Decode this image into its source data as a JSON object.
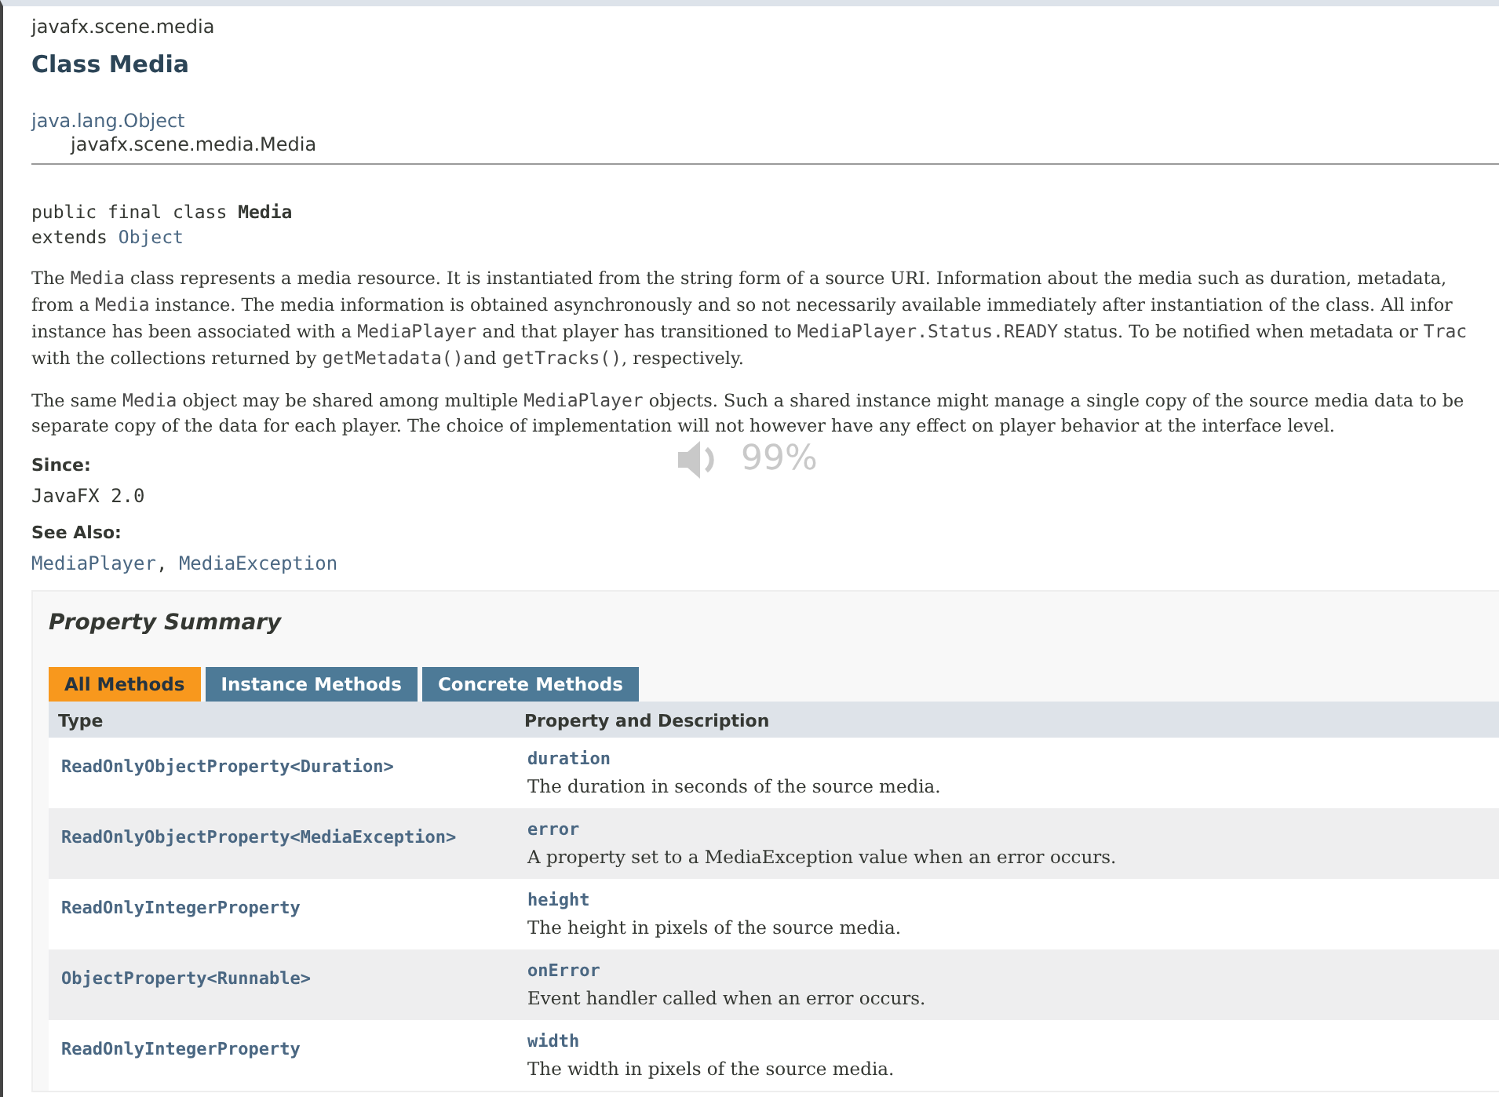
{
  "package": "javafx.scene.media",
  "title": "Class Media",
  "inheritance": [
    "java.lang.Object",
    "javafx.scene.media.Media"
  ],
  "signature": {
    "prefix": "public final class ",
    "name": "Media",
    "extends_keyword": "extends ",
    "extends_type": "Object"
  },
  "description": [
    [
      [
        {
          "text": "The ",
          "kind": "text"
        },
        {
          "text": "Media",
          "kind": "code"
        },
        {
          "text": " class represents a media resource. It is instantiated from the string form of a source URI. Information about the media such as duration, metadata,",
          "kind": "text"
        }
      ],
      [
        {
          "text": "from a ",
          "kind": "text"
        },
        {
          "text": "Media",
          "kind": "code"
        },
        {
          "text": " instance. The media information is obtained asynchronously and so not necessarily available immediately after instantiation of the class. All infor",
          "kind": "text"
        }
      ],
      [
        {
          "text": "instance has been associated with a ",
          "kind": "text"
        },
        {
          "text": "MediaPlayer",
          "kind": "code"
        },
        {
          "text": " and that player has transitioned to ",
          "kind": "text"
        },
        {
          "text": "MediaPlayer.Status.READY",
          "kind": "code"
        },
        {
          "text": " status. To be notified when metadata or ",
          "kind": "text"
        },
        {
          "text": "Trac",
          "kind": "code"
        }
      ],
      [
        {
          "text": "with the collections returned by ",
          "kind": "text"
        },
        {
          "text": "getMetadata()",
          "kind": "code"
        },
        {
          "text": "and ",
          "kind": "text"
        },
        {
          "text": "getTracks()",
          "kind": "code"
        },
        {
          "text": ", respectively.",
          "kind": "text"
        }
      ]
    ],
    [
      [
        {
          "text": "The same ",
          "kind": "text"
        },
        {
          "text": "Media",
          "kind": "code"
        },
        {
          "text": " object may be shared among multiple ",
          "kind": "text"
        },
        {
          "text": "MediaPlayer",
          "kind": "code"
        },
        {
          "text": " objects. Such a shared instance might manage a single copy of the source media data to be",
          "kind": "text"
        }
      ],
      [
        {
          "text": "separate copy of the data for each player. The choice of implementation will not however have any effect on player behavior at the interface level.",
          "kind": "text"
        }
      ]
    ]
  ],
  "since": {
    "label": "Since:",
    "value": "JavaFX 2.0"
  },
  "see_also": {
    "label": "See Also:",
    "links": [
      "MediaPlayer",
      "MediaException"
    ],
    "separator": ", "
  },
  "volume_overlay": {
    "text": "99%"
  },
  "property_summary": {
    "title": "Property Summary",
    "tabs": [
      {
        "label": "All Methods",
        "selected": true
      },
      {
        "label": "Instance Methods",
        "selected": false
      },
      {
        "label": "Concrete Methods",
        "selected": false
      }
    ],
    "columns": [
      "Type",
      "Property and Description"
    ],
    "rows": [
      {
        "type": "ReadOnlyObjectProperty<Duration>",
        "property": "duration",
        "description": "The duration in seconds of the source media."
      },
      {
        "type": "ReadOnlyObjectProperty<MediaException>",
        "property": "error",
        "description": "A property set to a MediaException value when an error occurs."
      },
      {
        "type": "ReadOnlyIntegerProperty",
        "property": "height",
        "description": "The height in pixels of the source media."
      },
      {
        "type": "ObjectProperty<Runnable>",
        "property": "onError",
        "description": "Event handler called when an error occurs."
      },
      {
        "type": "ReadOnlyIntegerProperty",
        "property": "width",
        "description": "The width in pixels of the source media."
      }
    ]
  }
}
